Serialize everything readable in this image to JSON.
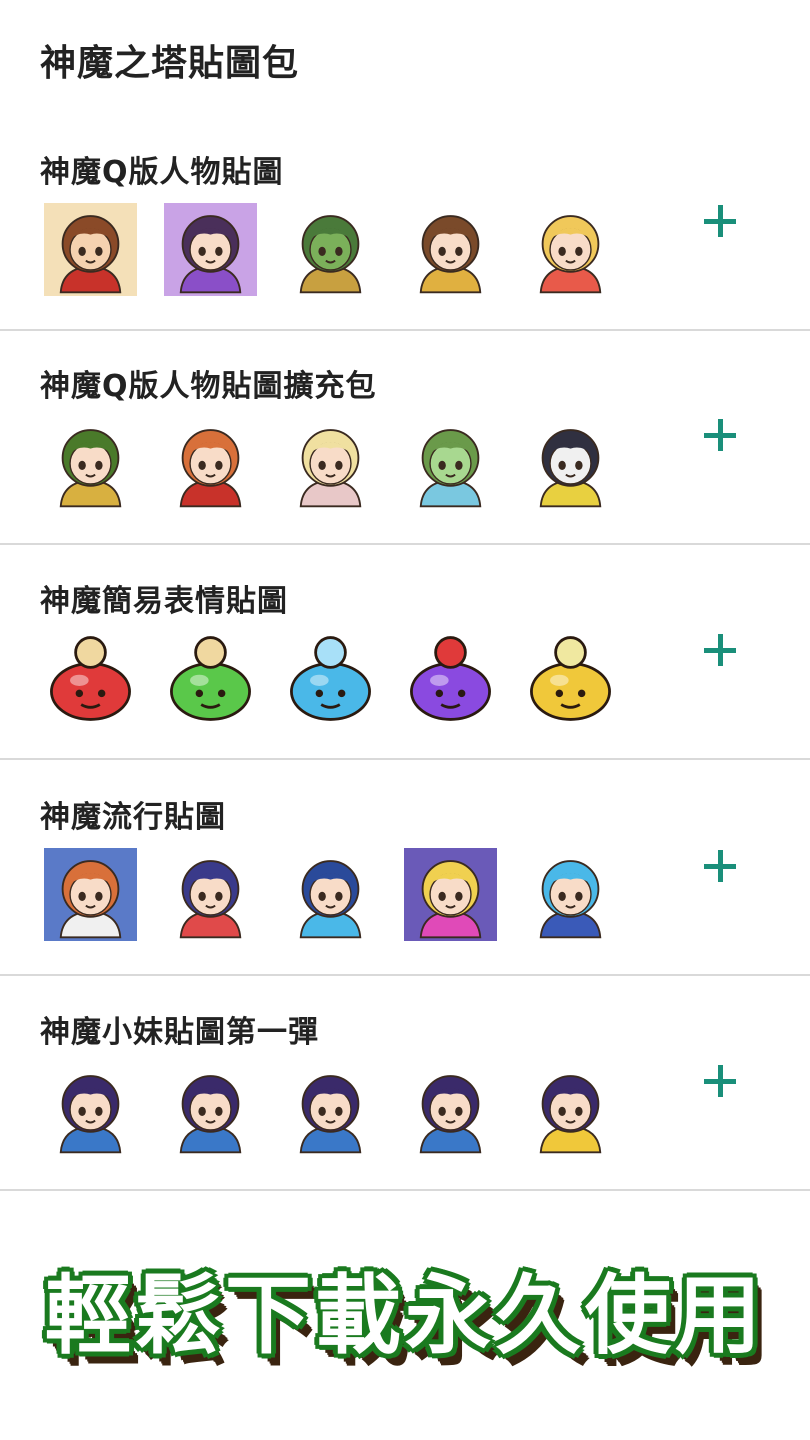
{
  "app": {
    "title": "神魔之塔貼圖包"
  },
  "packs": [
    {
      "title": "神魔Q版人物貼圖",
      "stickers": [
        {
          "icon": "chibi-hero-icon",
          "bg": "#f4e0b8",
          "skin": "#f5d2b0",
          "hair": "#8a4a28",
          "accent": "#c8322a"
        },
        {
          "icon": "chibi-dark-girl-icon",
          "bg": "#c9a3e6",
          "skin": "#f8dcc8",
          "hair": "#4a2f5a",
          "accent": "#8a4fc8"
        },
        {
          "icon": "chibi-green-warrior-icon",
          "bg": "#ffffff",
          "skin": "#7bb05a",
          "hair": "#4a7a3a",
          "accent": "#c8a040"
        },
        {
          "icon": "chibi-princess-icon",
          "bg": "#ffffff",
          "skin": "#f8dcc8",
          "hair": "#7a4a2a",
          "accent": "#e0b040"
        },
        {
          "icon": "chibi-blonde-girl-icon",
          "bg": "#ffffff",
          "skin": "#f8dcc8",
          "hair": "#f0c85a",
          "accent": "#e85a4a"
        }
      ],
      "add_label": "+"
    },
    {
      "title": "神魔Q版人物貼圖擴充包",
      "stickers": [
        {
          "icon": "chibi-hooded-girl-icon",
          "bg": "#ffffff",
          "skin": "#f8dcc8",
          "hair": "#4a7a2a",
          "accent": "#d8b040"
        },
        {
          "icon": "chibi-redhead-girl-icon",
          "bg": "#ffffff",
          "skin": "#f8dcc8",
          "hair": "#d8703a",
          "accent": "#c8322a"
        },
        {
          "icon": "chibi-nurse-girl-icon",
          "bg": "#ffffff",
          "skin": "#f8dcc8",
          "hair": "#f0e0a0",
          "accent": "#e8c8c8"
        },
        {
          "icon": "chibi-green-beast-icon",
          "bg": "#ffffff",
          "skin": "#a8d890",
          "hair": "#6a9a4a",
          "accent": "#7ac8e0"
        },
        {
          "icon": "chibi-white-beast-icon",
          "bg": "#ffffff",
          "skin": "#f0f0f0",
          "hair": "#303040",
          "accent": "#e8d040"
        }
      ],
      "add_label": "+"
    },
    {
      "title": "神魔簡易表情貼圖",
      "stickers": [
        {
          "icon": "red-slime-x-icon",
          "bg": "#ffffff",
          "skin": "#e03a3a",
          "hair": "#a01818",
          "accent": "#f0d8a0"
        },
        {
          "icon": "green-slime-o-icon",
          "bg": "#ffffff",
          "skin": "#5ac84a",
          "hair": "#2a8a2a",
          "accent": "#f0d8a0"
        },
        {
          "icon": "blue-slime-splash-icon",
          "bg": "#ffffff",
          "skin": "#4ab8e8",
          "hair": "#1a78b8",
          "accent": "#a8e0f8"
        },
        {
          "icon": "purple-slime-angry-icon",
          "bg": "#ffffff",
          "skin": "#8a4ae0",
          "hair": "#5a2aa8",
          "accent": "#e03a3a"
        },
        {
          "icon": "yellow-slime-halo-icon",
          "bg": "#ffffff",
          "skin": "#f0c83a",
          "hair": "#c8981a",
          "accent": "#f0e8a0"
        }
      ],
      "add_label": "+"
    },
    {
      "title": "神魔流行貼圖",
      "stickers": [
        {
          "icon": "horned-girl-sign-icon",
          "bg": "#5a7ac8",
          "skin": "#f8dcc8",
          "hair": "#d8703a",
          "accent": "#f0f0f0"
        },
        {
          "icon": "navy-hair-boy-icon",
          "bg": "#ffffff",
          "skin": "#f8dcc8",
          "hair": "#3a3a8a",
          "accent": "#e04a4a"
        },
        {
          "icon": "blue-hair-shout-icon",
          "bg": "#ffffff",
          "skin": "#f8dcc8",
          "hair": "#2a4a9a",
          "accent": "#4ab8e8"
        },
        {
          "icon": "purple-sleeping-icon",
          "bg": "#6a5ab8",
          "skin": "#f8dcc8",
          "hair": "#f0d050",
          "accent": "#e04ab8"
        },
        {
          "icon": "sitting-blue-hair-icon",
          "bg": "#ffffff",
          "skin": "#f8dcc8",
          "hair": "#4ab8e8",
          "accent": "#3a5ab8"
        }
      ],
      "add_label": "+"
    },
    {
      "title": "神魔小妹貼圖第一彈",
      "stickers": [
        {
          "icon": "girl-glare-icon",
          "bg": "#ffffff",
          "skin": "#f8dcc8",
          "hair": "#3a2a6a",
          "accent": "#3a78c8"
        },
        {
          "icon": "girl-scream-icon",
          "bg": "#ffffff",
          "skin": "#f8dcc8",
          "hair": "#3a2a6a",
          "accent": "#3a78c8"
        },
        {
          "icon": "girl-embarrassed-icon",
          "bg": "#ffffff",
          "skin": "#f8dcc8",
          "hair": "#3a2a6a",
          "accent": "#3a78c8"
        },
        {
          "icon": "girl-surprised-icon",
          "bg": "#ffffff",
          "skin": "#f8dcc8",
          "hair": "#3a2a6a",
          "accent": "#3a78c8"
        },
        {
          "icon": "girl-cheers-icon",
          "bg": "#ffffff",
          "skin": "#f8dcc8",
          "hair": "#3a2a6a",
          "accent": "#f0c83a"
        }
      ],
      "add_label": "+"
    }
  ],
  "banner": {
    "text": "輕鬆下載永久使用"
  }
}
